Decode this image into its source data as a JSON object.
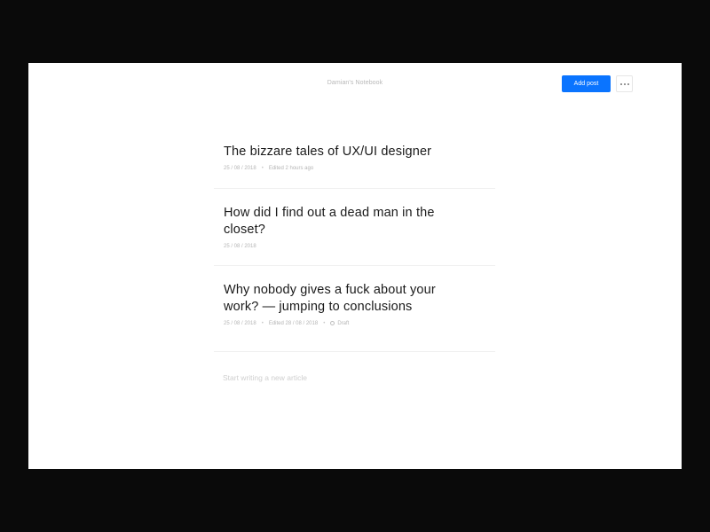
{
  "header": {
    "notebook_title": "Damian's Notebook",
    "add_post_label": "Add post",
    "more_icon": "more-horizontal-icon"
  },
  "posts": [
    {
      "title": "The bizzare tales of UX/UI designer",
      "date": "25 / 08 / 2018",
      "edited": "Edited 2 hours ago"
    },
    {
      "title": "How did I find out a dead man in the closet?",
      "date": "25 / 08 / 2018"
    },
    {
      "title": "Why nobody gives a fuck about your work? — jumping to conclusions",
      "date": "25 / 08 / 2018",
      "edited": "Edited 28 / 08 / 2018",
      "status": "Draft"
    }
  ],
  "composer": {
    "placeholder": "Start writing a new article"
  },
  "colors": {
    "accent": "#0A74FF",
    "background": "#0A0A0A",
    "surface": "#FFFFFF"
  }
}
